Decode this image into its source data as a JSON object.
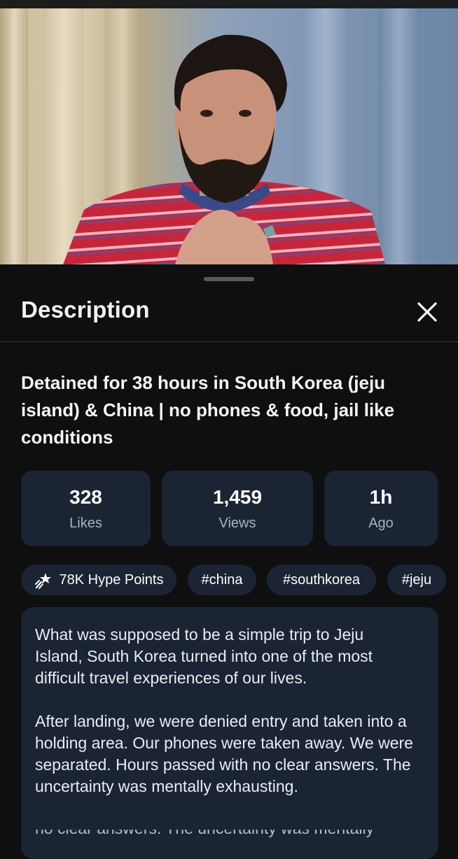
{
  "description_panel": {
    "heading": "Description",
    "video_title": "Detained for 38 hours in South Korea (jeju island) & China | no phones & food, jail like conditions",
    "stats": [
      {
        "value": "328",
        "label": "Likes"
      },
      {
        "value": "1,459",
        "label": "Views"
      },
      {
        "value": "1h",
        "label": "Ago"
      }
    ],
    "chips": [
      {
        "label": "78K Hype Points",
        "icon": "hype-rocket-icon"
      },
      {
        "label": "#china"
      },
      {
        "label": "#southkorea"
      },
      {
        "label": "#jeju"
      }
    ],
    "description_paragraphs": [
      "What was supposed to be a simple trip to Jeju Island, South Korea turned into one of the most difficult travel experiences of our lives.",
      "After landing, we were denied entry and taken into a holding area. Our phones were taken away. We were separated. Hours passed with no clear answers. The uncertainty was mentally exhausting."
    ],
    "overlap_text": "no clear answers. The uncertainty was mentally"
  },
  "icons": {
    "close": "close-icon",
    "hype": "hype-rocket-icon"
  },
  "colors": {
    "background": "#0f0f0f",
    "card": "#1a2433",
    "muted_text": "#aab2bf"
  }
}
